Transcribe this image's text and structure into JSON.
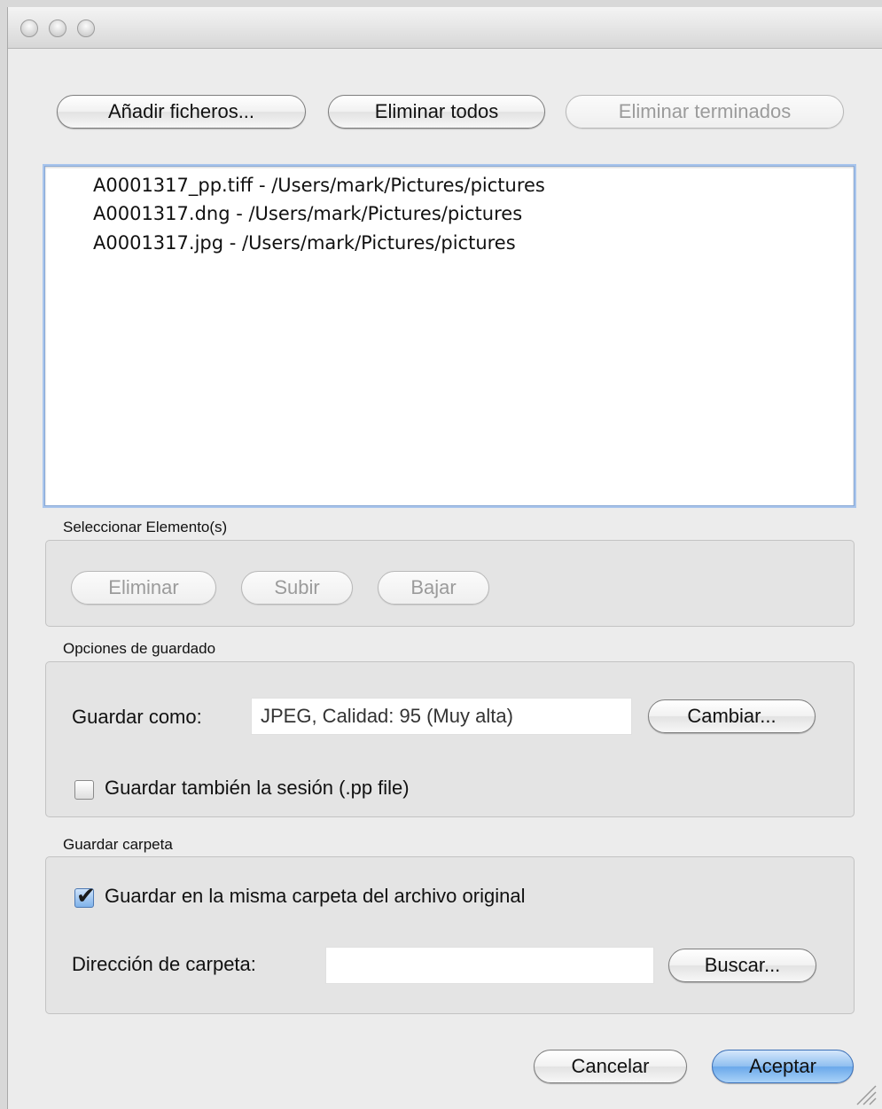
{
  "toolbar": {
    "add_files": "Añadir ficheros...",
    "remove_all": "Eliminar todos",
    "remove_finished": "Eliminar terminados"
  },
  "file_list": {
    "items": [
      "A0001317_pp.tiff - /Users/mark/Pictures/pictures",
      "A0001317.dng - /Users/mark/Pictures/pictures",
      "A0001317.jpg - /Users/mark/Pictures/pictures"
    ]
  },
  "select_group": {
    "title": "Seleccionar Elemento(s)",
    "remove": "Eliminar",
    "up": "Subir",
    "down": "Bajar"
  },
  "save_options": {
    "title": "Opciones de guardado",
    "save_as_label": "Guardar como:",
    "save_as_value": "JPEG, Calidad: 95 (Muy alta)",
    "change": "Cambiar...",
    "save_session_label": "Guardar también la sesión (.pp file)",
    "save_session_checked": false
  },
  "save_folder": {
    "title": "Guardar carpeta",
    "same_folder_label": "Guardar en la misma carpeta del archivo original",
    "same_folder_checked": true,
    "folder_path_label": "Dirección de carpeta:",
    "folder_path_value": "",
    "browse": "Buscar..."
  },
  "footer": {
    "cancel": "Cancelar",
    "accept": "Aceptar"
  }
}
